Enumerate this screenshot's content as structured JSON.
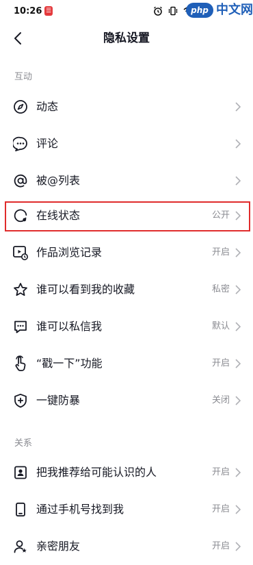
{
  "status_bar": {
    "time": "10:26",
    "app_badge": "☰",
    "watermark_pill": "php",
    "watermark_text": "中文网"
  },
  "nav": {
    "title": "隐私设置"
  },
  "sections": {
    "interaction": "互动",
    "relations": "关系"
  },
  "rows": [
    {
      "label": "动态",
      "value": "",
      "icon": "compass-icon"
    },
    {
      "label": "评论",
      "value": "",
      "icon": "comment-icon"
    },
    {
      "label": "被@列表",
      "value": "",
      "icon": "at-icon"
    },
    {
      "label": "在线状态",
      "value": "公开",
      "icon": "online-status-icon"
    },
    {
      "label": "作品浏览记录",
      "value": "开启",
      "icon": "view-history-icon"
    },
    {
      "label": "谁可以看到我的收藏",
      "value": "私密",
      "icon": "star-icon"
    },
    {
      "label": "谁可以私信我",
      "value": "默认",
      "icon": "message-icon"
    },
    {
      "label": "“戳一下”功能",
      "value": "开启",
      "icon": "poke-hand-icon"
    },
    {
      "label": "一键防暴",
      "value": "关闭",
      "icon": "shield-plus-icon"
    },
    {
      "label": "把我推荐给可能认识的人",
      "value": "开启",
      "icon": "contact-card-icon"
    },
    {
      "label": "通过手机号找到我",
      "value": "开启",
      "icon": "phone-icon"
    },
    {
      "label": "亲密朋友",
      "value": "开启",
      "icon": "close-friend-icon"
    }
  ],
  "colors": {
    "highlight": "#e02b2b",
    "secondary_text": "#8a8b91"
  }
}
